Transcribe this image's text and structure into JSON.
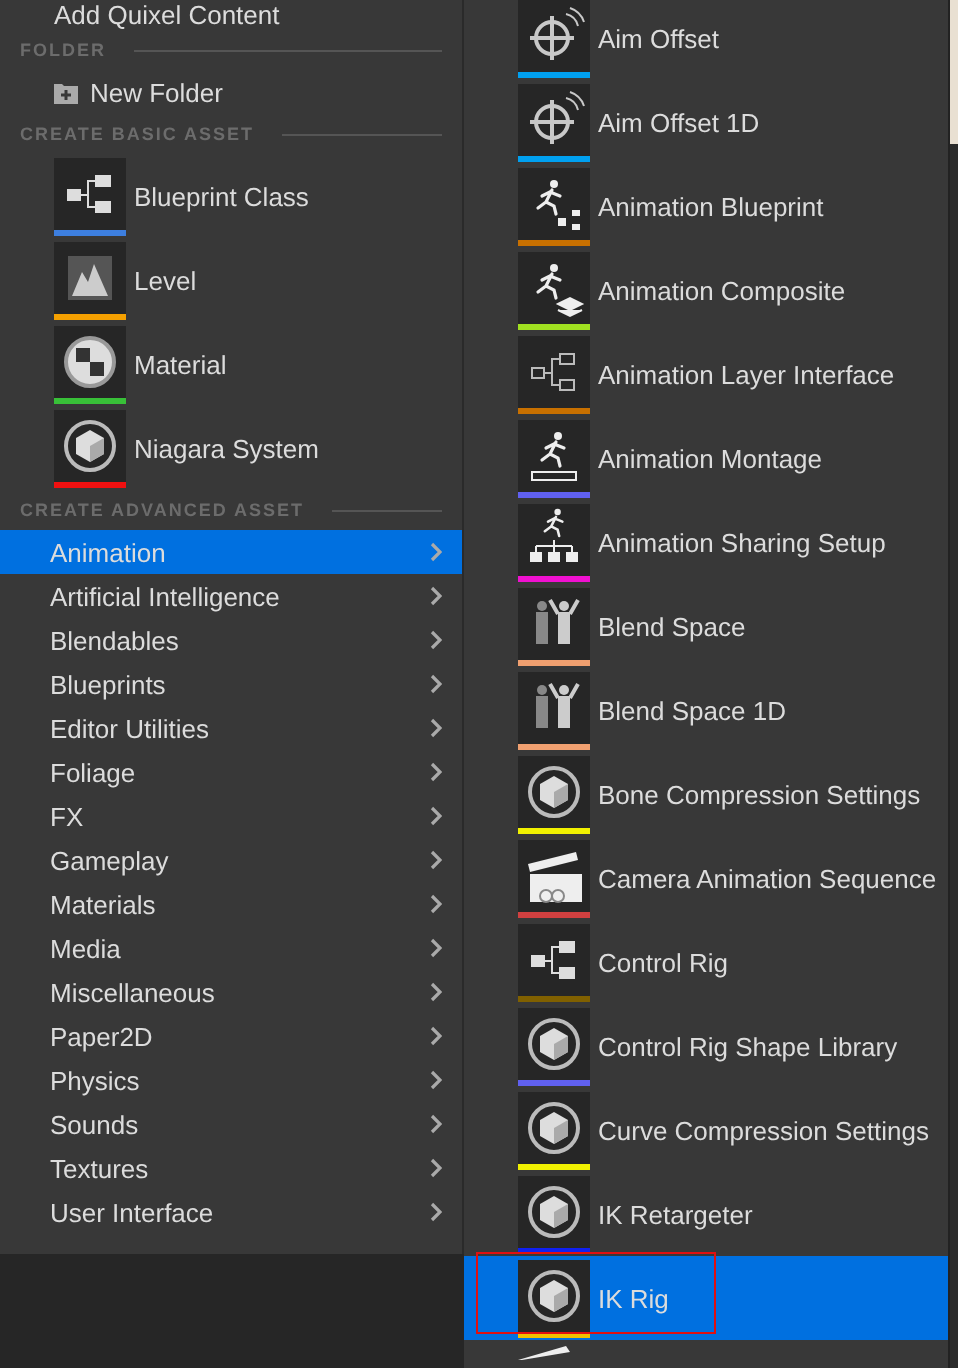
{
  "menu": {
    "top_item": {
      "label": "Add Quixel Content"
    },
    "sections": [
      {
        "title": "FOLDER",
        "kind": "plain",
        "items": [
          {
            "label": "New Folder"
          }
        ]
      },
      {
        "title": "CREATE BASIC ASSET",
        "kind": "asset",
        "items": [
          {
            "label": "Blueprint Class",
            "color": "#3d7fe0"
          },
          {
            "label": "Level",
            "color": "#f5a000"
          },
          {
            "label": "Material",
            "color": "#38c038"
          },
          {
            "label": "Niagara System",
            "color": "#f01010"
          }
        ]
      },
      {
        "title": "CREATE ADVANCED ASSET",
        "kind": "category",
        "items": [
          {
            "label": "Animation",
            "selected": true
          },
          {
            "label": "Artificial Intelligence",
            "selected": false
          },
          {
            "label": "Blendables",
            "selected": false
          },
          {
            "label": "Blueprints",
            "selected": false
          },
          {
            "label": "Editor Utilities",
            "selected": false
          },
          {
            "label": "Foliage",
            "selected": false
          },
          {
            "label": "FX",
            "selected": false
          },
          {
            "label": "Gameplay",
            "selected": false
          },
          {
            "label": "Materials",
            "selected": false
          },
          {
            "label": "Media",
            "selected": false
          },
          {
            "label": "Miscellaneous",
            "selected": false
          },
          {
            "label": "Paper2D",
            "selected": false
          },
          {
            "label": "Physics",
            "selected": false
          },
          {
            "label": "Sounds",
            "selected": false
          },
          {
            "label": "Textures",
            "selected": false
          },
          {
            "label": "User Interface",
            "selected": false
          }
        ]
      }
    ]
  },
  "submenu": {
    "items": [
      {
        "label": "Aim Offset",
        "color": "#00a0f0",
        "selected": false
      },
      {
        "label": "Aim Offset 1D",
        "color": "#00a0f0",
        "selected": false
      },
      {
        "label": "Animation Blueprint",
        "color": "#c87000",
        "selected": false
      },
      {
        "label": "Animation Composite",
        "color": "#a0e020",
        "selected": false
      },
      {
        "label": "Animation Layer Interface",
        "color": "#c87000",
        "selected": false
      },
      {
        "label": "Animation Montage",
        "color": "#6060f0",
        "selected": false
      },
      {
        "label": "Animation Sharing Setup",
        "color": "#f010d0",
        "selected": false
      },
      {
        "label": "Blend Space",
        "color": "#f0a070",
        "selected": false
      },
      {
        "label": "Blend Space 1D",
        "color": "#f0a070",
        "selected": false
      },
      {
        "label": "Bone Compression Settings",
        "color": "#f0f000",
        "selected": false
      },
      {
        "label": "Camera Animation Sequence",
        "color": "#d04040",
        "selected": false
      },
      {
        "label": "Control Rig",
        "color": "#806000",
        "selected": false
      },
      {
        "label": "Control Rig Shape Library",
        "color": "#6060f0",
        "selected": false
      },
      {
        "label": "Curve Compression Settings",
        "color": "#f0f000",
        "selected": false
      },
      {
        "label": "IK Retargeter",
        "color": "#1020f0",
        "selected": false
      },
      {
        "label": "IK Rig",
        "color": "#f0c000",
        "selected": true,
        "highlighted": true
      }
    ]
  }
}
